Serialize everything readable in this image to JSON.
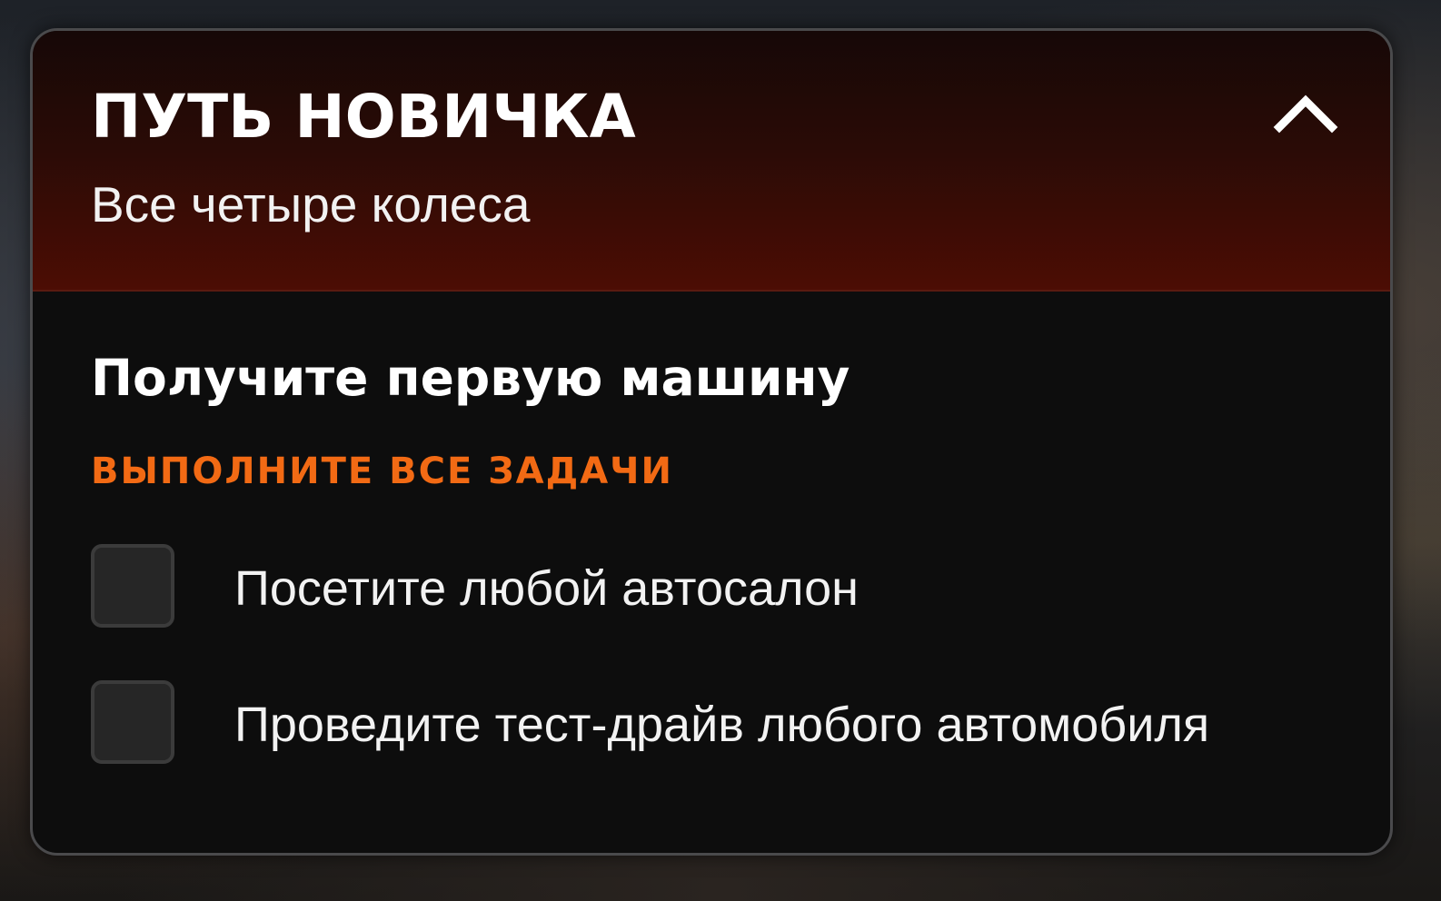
{
  "panel": {
    "title": "ПУТЬ НОВИЧКА",
    "subtitle": "Все четыре колеса",
    "collapse_icon": "chevron-up-icon"
  },
  "quest": {
    "title": "Получите первую машину",
    "tasks_label": "ВЫПОЛНИТЕ ВСЕ ЗАДАЧИ",
    "tasks": [
      {
        "label": "Посетите любой автосалон",
        "checked": false
      },
      {
        "label": "Проведите тест-драйв любого автомобиля",
        "checked": false
      }
    ]
  },
  "colors": {
    "accent": "#f26a14",
    "header_gradient_top": "#160807",
    "header_gradient_bottom": "#4c0d04",
    "panel_background": "#0d0d0d"
  }
}
